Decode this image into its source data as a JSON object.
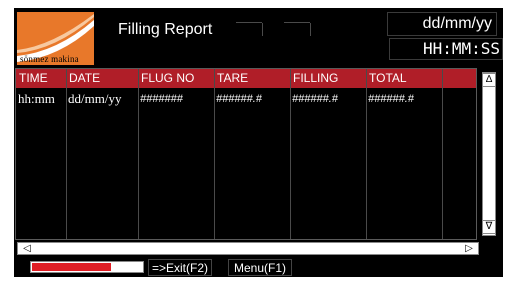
{
  "header": {
    "logo_text": "sönmez makina",
    "title": "Filling Report",
    "date": "dd/mm/yy",
    "time": "HH:MM:SS"
  },
  "table": {
    "columns": [
      "TIME",
      "DATE",
      "FLUG NO",
      "TARE",
      "FILLING",
      "TOTAL"
    ],
    "rows": [
      [
        "hh:mm",
        "dd/mm/yy",
        "#######",
        "######.#",
        "######.#",
        "######.#"
      ]
    ]
  },
  "scrollbars": {
    "up": "∆",
    "down": "∇",
    "left": "◁",
    "right": "▷"
  },
  "footer": {
    "progress": 0.72,
    "exit_label": "=>Exit(F2)",
    "menu_label": "Menu(F1)"
  },
  "colors": {
    "header_row": "#b01e28",
    "logo_bg": "#e8782a",
    "progress_fill": "#e01e25",
    "screen_bg": "#000000"
  }
}
